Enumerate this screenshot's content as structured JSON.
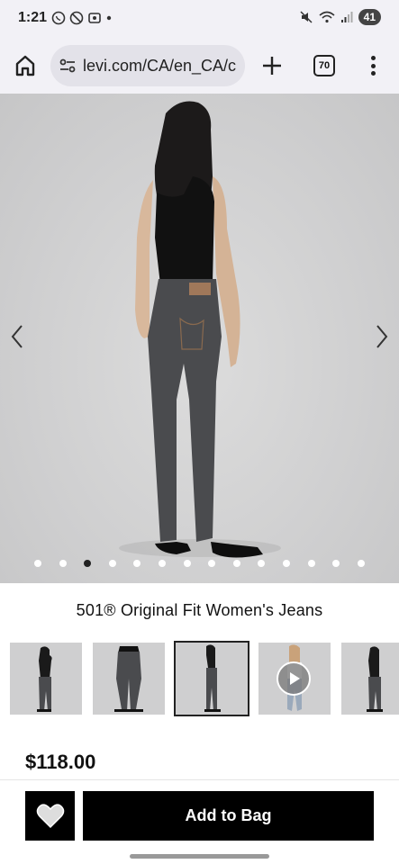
{
  "status_bar": {
    "time": "1:21",
    "battery": "41"
  },
  "browser": {
    "url": "levi.com/CA/en_CA/c",
    "tab_count": "70"
  },
  "gallery": {
    "dot_count": 14,
    "active_dot": 3
  },
  "product": {
    "title": "501® Original Fit Women's Jeans",
    "price": "$118.00"
  },
  "actions": {
    "add_to_bag": "Add to Bag"
  },
  "colors": {
    "accent": "#000000",
    "denim": "#4a4b4e"
  }
}
